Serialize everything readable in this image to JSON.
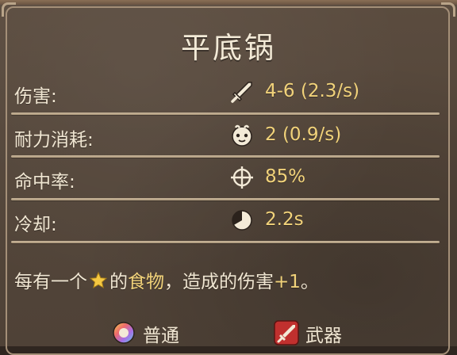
{
  "item": {
    "name": "平底锅"
  },
  "stats": [
    {
      "label": "伤害:",
      "icon": "sword-icon",
      "value": "4-6 (2.3/s)"
    },
    {
      "label": "耐力消耗:",
      "icon": "stamina-icon",
      "value": "2 (0.9/s)"
    },
    {
      "label": "命中率:",
      "icon": "crosshair-icon",
      "value": "85%"
    },
    {
      "label": "冷却:",
      "icon": "cooldown-icon",
      "value": "2.2s"
    }
  ],
  "description": {
    "prefix": "每有一个",
    "star_icon": "star-icon",
    "middle": "的",
    "keyword": "食物",
    "suffix": "，造成的伤害",
    "bonus": "+1",
    "end": "。"
  },
  "tags": {
    "rarity": {
      "icon": "rainbow-orb-icon",
      "label": "普通"
    },
    "type": {
      "icon": "weapon-icon",
      "label": "武器"
    }
  },
  "colors": {
    "value_text": "#f1d27a",
    "label_text": "#f0e6d2",
    "panel_bg": "#54463a",
    "divider": "#cdbb9e",
    "weapon_tag": "#c0302e"
  }
}
